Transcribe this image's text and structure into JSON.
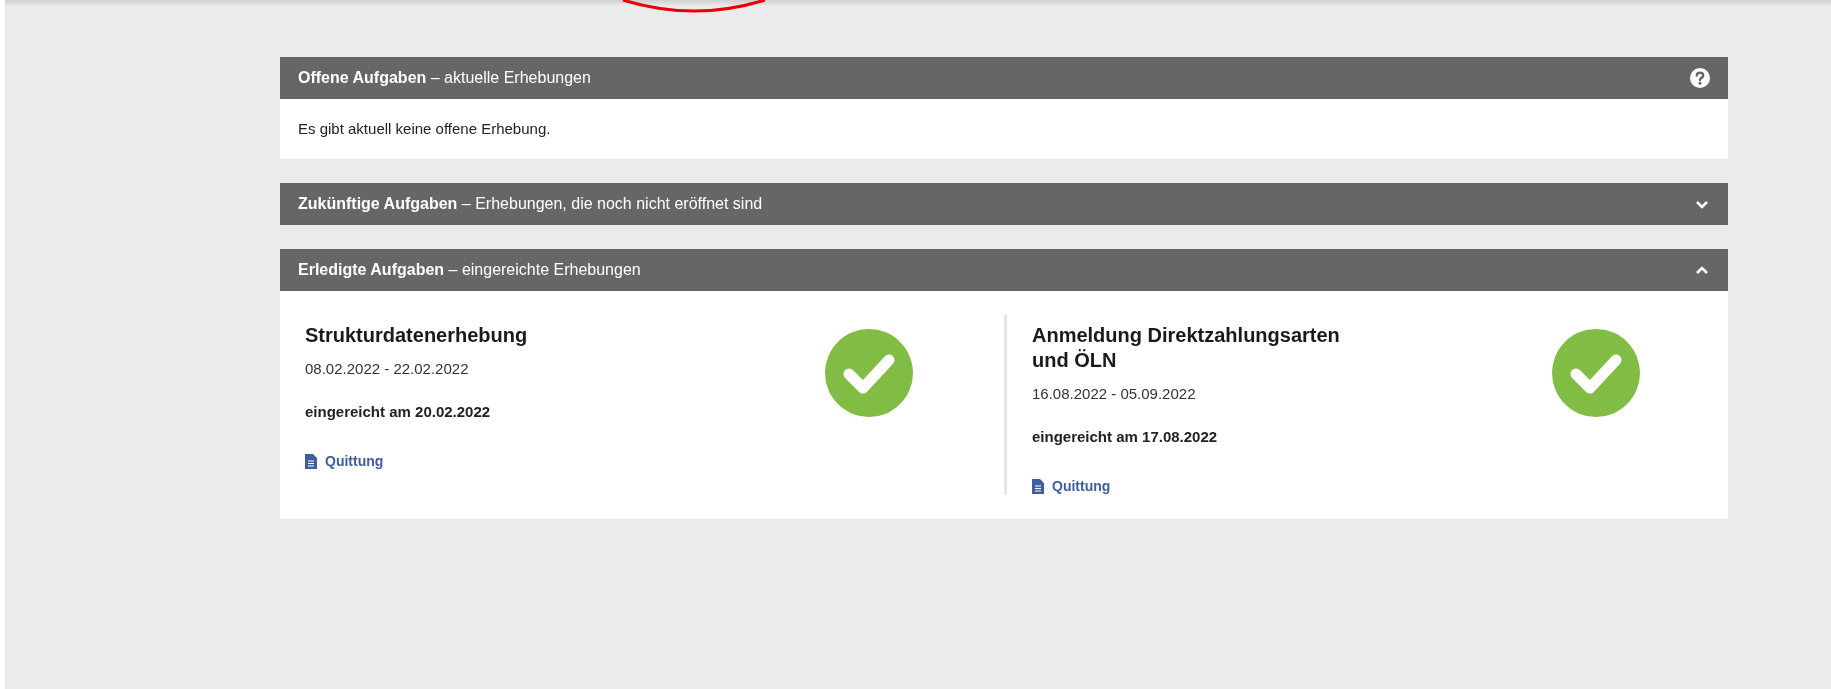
{
  "panels": [
    {
      "kind": "help",
      "heading": "**Offene Aufgaben** – aktuelle Erhebungen",
      "expanded": true,
      "message": "Es gibt aktuell keine offene Erhebung."
    },
    {
      "kind": "toggle",
      "heading": "**Zukünftige Aufgaben** – Erhebungen, die noch nicht eröffnet sind",
      "expanded": false
    },
    {
      "kind": "toggle",
      "heading": "**Erledigte Aufgaben** – eingereichte Erhebungen",
      "expanded": true,
      "items": [
        {
          "title": "Strukturdatenerhebung",
          "period": "08.02.2022 - 22.02.2022",
          "submitted": "eingereicht am 20.02.2022",
          "link": "Quittung"
        },
        {
          "title": "Anmeldung Direktzahlungsarten und ÖLN",
          "period": "16.08.2022 - 05.09.2022",
          "submitted": "eingereicht am 17.08.2022",
          "link": "Quittung"
        }
      ]
    }
  ]
}
